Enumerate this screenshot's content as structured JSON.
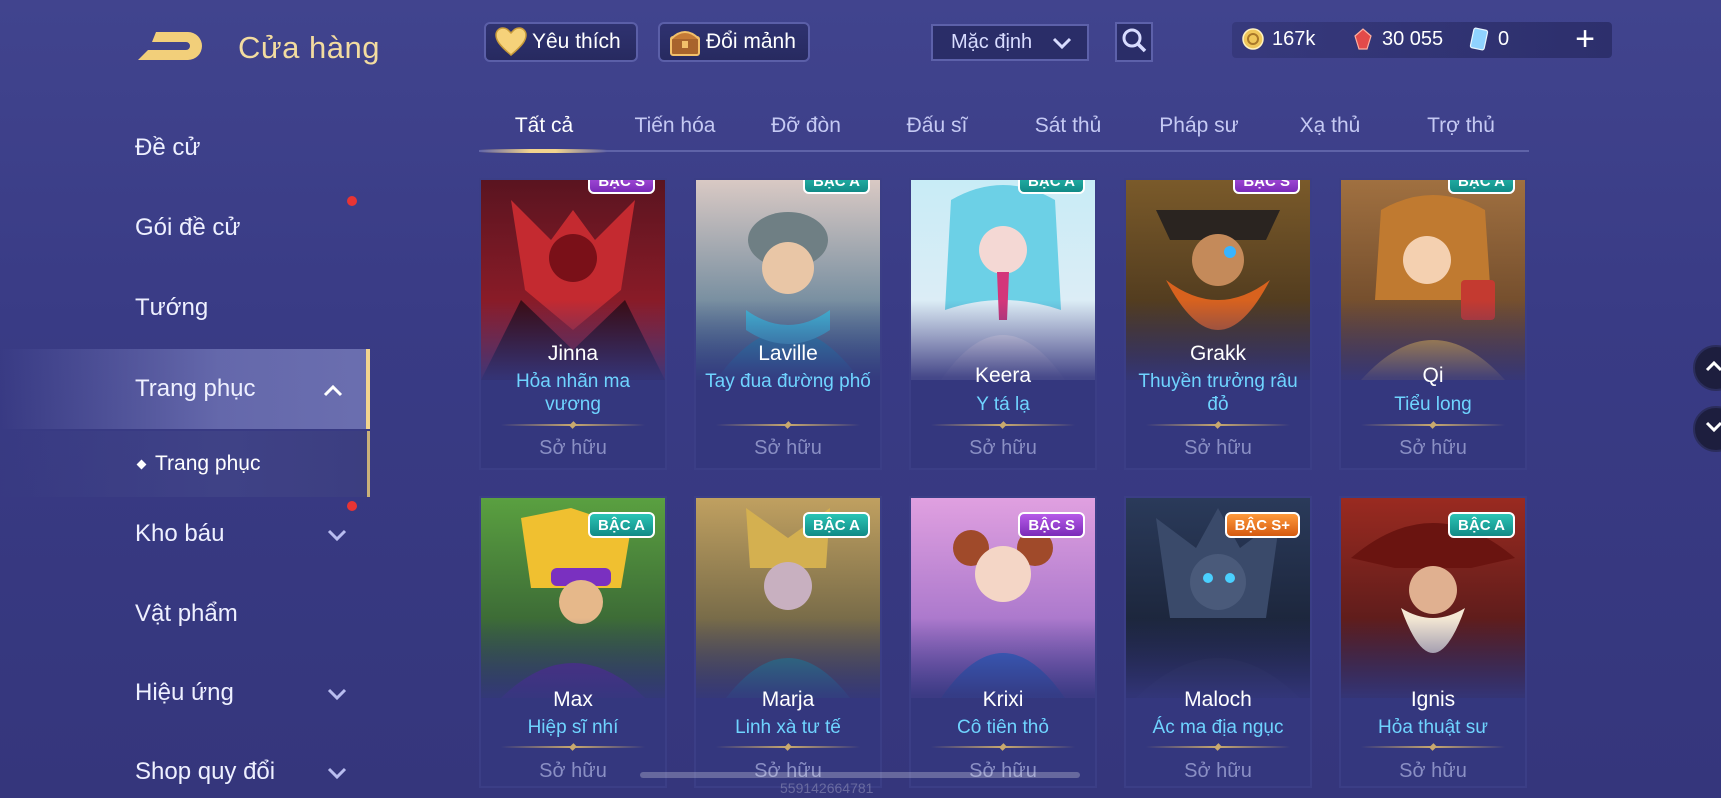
{
  "header": {
    "title": "Cửa hàng",
    "favorite_label": "Yêu thích",
    "shard_label": "Đổi mảnh",
    "sort_value": "Mặc định"
  },
  "currency": {
    "gold": "167k",
    "gems": "30 055",
    "vouchers": "0",
    "plus_label": "+"
  },
  "sidebar": {
    "items": [
      {
        "label": "Đề cử"
      },
      {
        "label": "Gói đề cử"
      },
      {
        "label": "Tướng"
      },
      {
        "label": "Trang phục"
      },
      {
        "label": "Kho báu"
      },
      {
        "label": "Vật phẩm"
      },
      {
        "label": "Hiệu ứng"
      },
      {
        "label": "Shop quy đổi"
      }
    ],
    "sub_item": "Trang phục"
  },
  "tabs": [
    "Tất cả",
    "Tiến hóa",
    "Đỡ đòn",
    "Đấu sĩ",
    "Sát thủ",
    "Pháp sư",
    "Xạ thủ",
    "Trợ thủ"
  ],
  "cards": [
    {
      "hero": "Jinna",
      "skin": "Hỏa nhãn ma vương",
      "status": "Sở hữu",
      "badge": "BẬC S"
    },
    {
      "hero": "Laville",
      "skin": "Tay đua đường phố",
      "status": "Sở hữu",
      "badge": "BẬC A"
    },
    {
      "hero": "Keera",
      "skin": "Y tá lạ",
      "status": "Sở hữu",
      "badge": "BẬC A"
    },
    {
      "hero": "Grakk",
      "skin": "Thuyền trưởng râu đỏ",
      "status": "Sở hữu",
      "badge": "BẬC S"
    },
    {
      "hero": "Qi",
      "skin": "Tiểu long",
      "status": "Sở hữu",
      "badge": "BẬC A"
    },
    {
      "hero": "Max",
      "skin": "Hiệp sĩ nhí",
      "status": "Sở hữu",
      "badge": "BẬC A"
    },
    {
      "hero": "Marja",
      "skin": "Linh xà tư tế",
      "status": "Sở hữu",
      "badge": "BẬC A"
    },
    {
      "hero": "Krixi",
      "skin": "Cô tiên thỏ",
      "status": "Sở hữu",
      "badge": "BẬC S"
    },
    {
      "hero": "Maloch",
      "skin": "Ác ma địa ngục",
      "status": "Sở hữu",
      "badge": "BẬC S+"
    },
    {
      "hero": "Ignis",
      "skin": "Hỏa thuật sư",
      "status": "Sở hữu",
      "badge": "BẬC A"
    }
  ],
  "footer": {
    "uid": "559142664781"
  },
  "colors": {
    "accent_gold": "#f2d48e",
    "skin_name": "#6fd4ff",
    "badge_a": "#2bc4b5",
    "badge_s": "#b65ae8",
    "badge_sp": "#ff9a3c"
  }
}
